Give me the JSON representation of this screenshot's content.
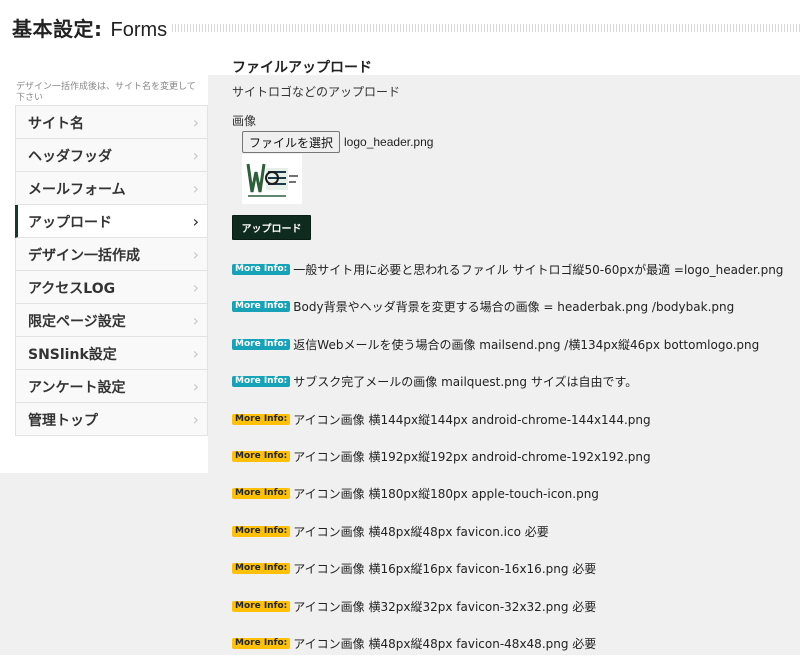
{
  "header": {
    "title_main": "基本設定:",
    "title_sub": "Forms"
  },
  "sidebar": {
    "note": "デザイン一括作成後は、サイト名を変更して下さい",
    "chevron": "›",
    "items": [
      {
        "label": "サイト名",
        "active": false
      },
      {
        "label": "ヘッダフッダ",
        "active": false
      },
      {
        "label": "メールフォーム",
        "active": false
      },
      {
        "label": "アップロード",
        "active": true
      },
      {
        "label": "デザイン一括作成",
        "active": false
      },
      {
        "label": "アクセスLOG",
        "active": false
      },
      {
        "label": "限定ページ設定",
        "active": false
      },
      {
        "label": "SNSlink設定",
        "active": false
      },
      {
        "label": "アンケート設定",
        "active": false
      },
      {
        "label": "管理トップ",
        "active": false
      }
    ]
  },
  "main": {
    "section_title": "ファイルアップロード",
    "section_sub": "サイトロゴなどのアップロード",
    "field_label": "画像",
    "file_button": "ファイルを選択",
    "file_name": "logo_header.png",
    "upload_button": "アップロード",
    "info_rows": [
      {
        "badge": "More Info:",
        "badge_color": "#17a2b8",
        "text": "一般サイト用に必要と思われるファイル サイトロゴ縦50-60pxが最適 =logo_header.png"
      },
      {
        "badge": "More Info:",
        "badge_color": "#17a2b8",
        "text": "Body背景やヘッダ背景を変更する場合の画像 = headerbak.png /bodybak.png"
      },
      {
        "badge": "More Info:",
        "badge_color": "#17a2b8",
        "text": "返信Webメールを使う場合の画像 mailsend.png /横134px縦46px bottomlogo.png"
      },
      {
        "badge": "More Info:",
        "badge_color": "#17a2b8",
        "text": "サブスク完了メールの画像 mailquest.png サイズは自由です。"
      },
      {
        "badge": "More Info:",
        "badge_color": "#ffc107",
        "text": "アイコン画像 横144px縦144px android-chrome-144x144.png"
      },
      {
        "badge": "More Info:",
        "badge_color": "#ffc107",
        "text": "アイコン画像 横192px縦192px android-chrome-192x192.png"
      },
      {
        "badge": "More Info:",
        "badge_color": "#ffc107",
        "text": "アイコン画像 横180px縦180px apple-touch-icon.png"
      },
      {
        "badge": "More Info:",
        "badge_color": "#ffc107",
        "text": "アイコン画像 横48px縦48px favicon.ico 必要"
      },
      {
        "badge": "More Info:",
        "badge_color": "#ffc107",
        "text": "アイコン画像 横16px縦16px favicon-16x16.png 必要"
      },
      {
        "badge": "More Info:",
        "badge_color": "#ffc107",
        "text": "アイコン画像 横32px縦32px favicon-32x32.png 必要"
      },
      {
        "badge": "More Info:",
        "badge_color": "#ffc107",
        "text": "アイコン画像 横48px縦48px favicon-48x48.png 必要"
      }
    ]
  }
}
